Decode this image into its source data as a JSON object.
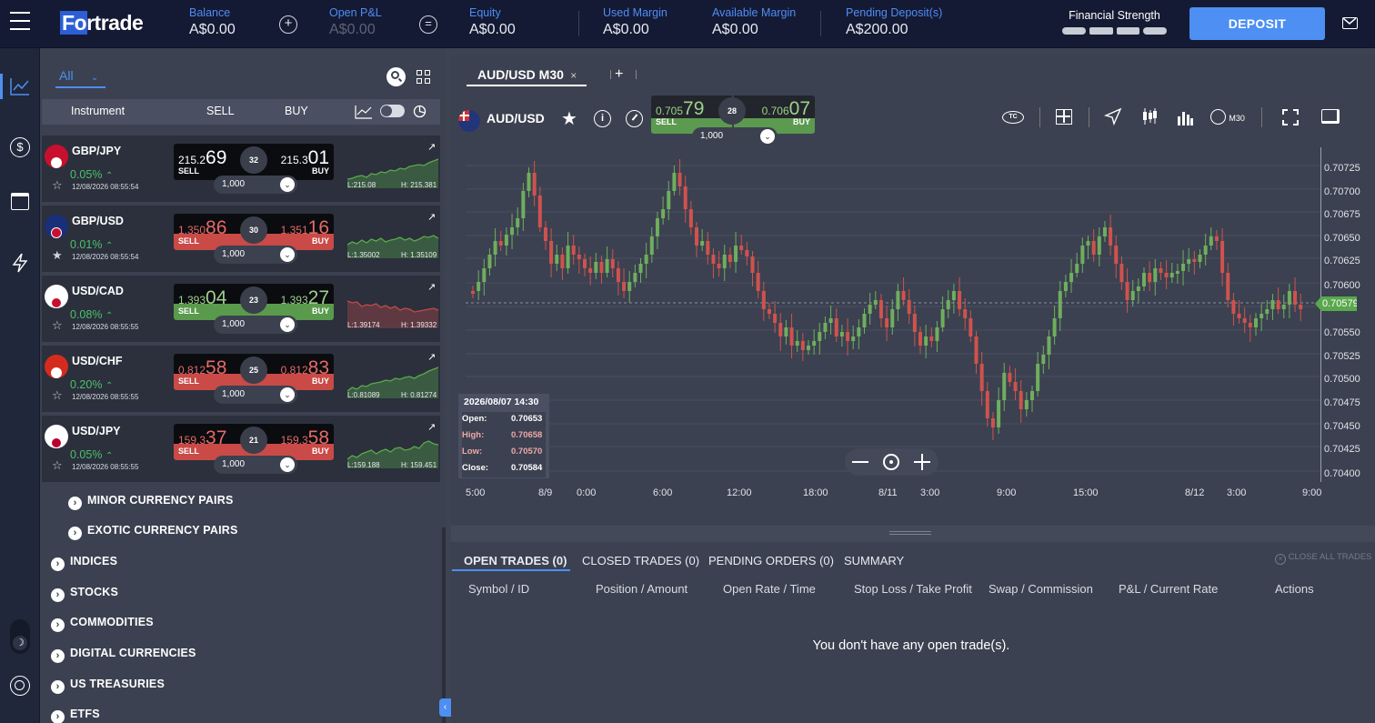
{
  "header": {
    "logo": "Fortrade",
    "metrics": [
      {
        "label": "Balance",
        "value": "A$0.00"
      },
      {
        "label": "Open P&L",
        "value": "A$0.00"
      },
      {
        "label": "Equity",
        "value": "A$0.00"
      },
      {
        "label": "Used Margin",
        "value": "A$0.00"
      },
      {
        "label": "Available Margin",
        "value": "A$0.00"
      },
      {
        "label": "Pending Deposit(s)",
        "value": "A$200.00"
      }
    ],
    "financial_strength_label": "Financial Strength",
    "deposit_label": "DEPOSIT"
  },
  "colors": {
    "accent": "#4d8ff2",
    "up": "#5aa84d",
    "down": "#d9534f",
    "topbar": "#141a33"
  },
  "watchlist": {
    "filter": "All",
    "columns": {
      "instrument": "Instrument",
      "sell": "SELL",
      "buy": "BUY"
    },
    "rows": [
      {
        "symbol": "GBP/JPY",
        "change": "0.05%",
        "time": "12/08/2026 08:55:54",
        "sell_small": "215.2",
        "sell_big": "69",
        "buy_small": "215.3",
        "buy_big": "01",
        "spread": "32",
        "qty": "1,000",
        "low": "L:215.08",
        "high": "H: 215.381",
        "sell_label": "SELL",
        "buy_label": "BUY",
        "starred": false
      },
      {
        "symbol": "GBP/USD",
        "change": "0.01%",
        "time": "12/08/2026 08:55:54",
        "sell_small": "1.350",
        "sell_big": "86",
        "buy_small": "1.351",
        "buy_big": "16",
        "spread": "30",
        "qty": "1,000",
        "low": "L:1.35002",
        "high": "H: 1.35109",
        "sell_label": "SELL",
        "buy_label": "BUY",
        "starred": true
      },
      {
        "symbol": "USD/CAD",
        "change": "0.08%",
        "time": "12/08/2026 08:55:55",
        "sell_small": "1.393",
        "sell_big": "04",
        "buy_small": "1.393",
        "buy_big": "27",
        "spread": "23",
        "qty": "1,000",
        "low": "L:1.39174",
        "high": "H: 1.39332",
        "sell_label": "SELL",
        "buy_label": "BUY",
        "starred": false
      },
      {
        "symbol": "USD/CHF",
        "change": "0.20%",
        "time": "12/08/2026 08:55:55",
        "sell_small": "0.812",
        "sell_big": "58",
        "buy_small": "0.812",
        "buy_big": "83",
        "spread": "25",
        "qty": "1,000",
        "low": "L:0.81089",
        "high": "H: 0.81274",
        "sell_label": "SELL",
        "buy_label": "BUY",
        "starred": false
      },
      {
        "symbol": "USD/JPY",
        "change": "0.05%",
        "time": "12/08/2026 08:55:55",
        "sell_small": "159.3",
        "sell_big": "37",
        "buy_small": "159.3",
        "buy_big": "58",
        "spread": "21",
        "qty": "1,000",
        "low": "L:159.188",
        "high": "H: 159.451",
        "sell_label": "SELL",
        "buy_label": "BUY",
        "starred": false
      }
    ],
    "subcategories": [
      "MINOR CURRENCY PAIRS",
      "EXOTIC CURRENCY PAIRS"
    ],
    "categories": [
      "INDICES",
      "STOCKS",
      "COMMODITIES",
      "DIGITAL CURRENCIES",
      "US TREASURIES",
      "ETFS"
    ]
  },
  "chart": {
    "tab_label": "AUD/USD M30",
    "symbol": "AUD/USD",
    "sell_small": "0.705",
    "sell_big": "79",
    "buy_small": "0.706",
    "buy_big": "07",
    "sell_label": "SELL",
    "buy_label": "BUY",
    "spread": "28",
    "qty": "1,000",
    "timeframe": "M30",
    "current_price": "0.70579",
    "tooltip": {
      "date": "2026/08/07 14:30",
      "open_label": "Open:",
      "open": "0.70653",
      "high_label": "High:",
      "high": "0.70658",
      "low_label": "Low:",
      "low": "0.70570",
      "close_label": "Close:",
      "close": "0.70584"
    }
  },
  "chart_data": {
    "type": "candlestick",
    "title": "AUD/USD M30",
    "y_ticks": [
      "0.70725",
      "0.70700",
      "0.70675",
      "0.70650",
      "0.70625",
      "0.70600",
      "0.70550",
      "0.70525",
      "0.70500",
      "0.70475",
      "0.70450",
      "0.70425",
      "0.70400"
    ],
    "x_ticks": [
      "5:00",
      "8/9",
      "0:00",
      "6:00",
      "12:00",
      "18:00",
      "8/11",
      "3:00",
      "9:00",
      "15:00",
      "8/12",
      "3:00",
      "9:00"
    ],
    "ylim": [
      0.70393,
      0.70737
    ],
    "last_price": 0.70579
  },
  "trades": {
    "tabs": [
      "OPEN TRADES (0)",
      "CLOSED TRADES (0)",
      "PENDING ORDERS (0)",
      "SUMMARY"
    ],
    "close_all": "CLOSE ALL TRADES",
    "columns": [
      "Symbol / ID",
      "Position / Amount",
      "Open Rate / Time",
      "Stop Loss / Take Profit",
      "Swap / Commission",
      "P&L / Current Rate",
      "Actions"
    ],
    "empty_message": "You don't have any open trade(s)."
  }
}
